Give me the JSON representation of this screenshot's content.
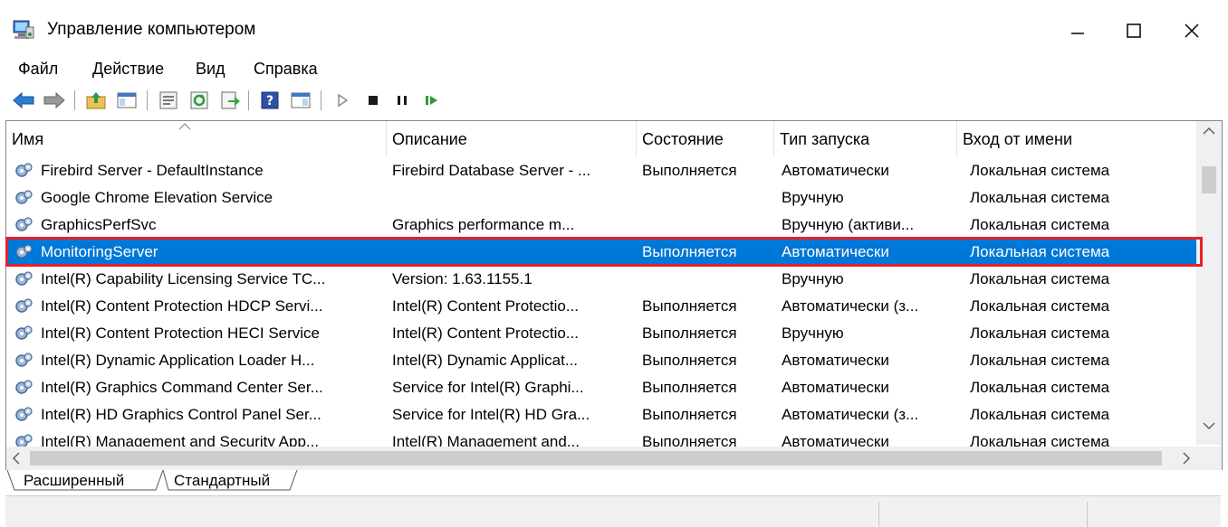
{
  "window": {
    "title": "Управление компьютером",
    "icon": "computer-management-icon"
  },
  "menu": [
    "Файл",
    "Действие",
    "Вид",
    "Справка"
  ],
  "toolbar": {
    "icons": [
      "back-arrow-icon",
      "forward-arrow-icon",
      "up-folder-icon",
      "console-tree-icon",
      "properties-icon",
      "refresh-icon",
      "export-list-icon",
      "help-icon",
      "show-hide-icon",
      "start-service-icon",
      "stop-service-icon",
      "pause-service-icon",
      "resume-service-icon"
    ]
  },
  "columns": [
    "Имя",
    "Описание",
    "Состояние",
    "Тип запуска",
    "Вход от имени"
  ],
  "rows": [
    {
      "name": "Firebird Server - DefaultInstance",
      "description": "Firebird Database Server - ...",
      "status": "Выполняется",
      "startup": "Автоматически",
      "logon": "Локальная система"
    },
    {
      "name": "Google Chrome Elevation Service",
      "description": "",
      "status": "",
      "startup": "Вручную",
      "logon": "Локальная система"
    },
    {
      "name": "GraphicsPerfSvc",
      "description": "Graphics performance m...",
      "status": "",
      "startup": "Вручную (активи...",
      "logon": "Локальная система"
    },
    {
      "name": "MonitoringServer",
      "description": "",
      "status": "Выполняется",
      "startup": "Автоматически",
      "logon": "Локальная система",
      "selected": true
    },
    {
      "name": "Intel(R) Capability Licensing Service TC...",
      "description": "Version: 1.63.1155.1",
      "status": "",
      "startup": "Вручную",
      "logon": "Локальная система"
    },
    {
      "name": "Intel(R) Content Protection HDCP Servi...",
      "description": "Intel(R) Content Protectio...",
      "status": "Выполняется",
      "startup": "Автоматически (з...",
      "logon": "Локальная система"
    },
    {
      "name": "Intel(R) Content Protection HECI Service",
      "description": "Intel(R) Content Protectio...",
      "status": "Выполняется",
      "startup": "Вручную",
      "logon": "Локальная система"
    },
    {
      "name": "Intel(R) Dynamic Application Loader H...",
      "description": "Intel(R) Dynamic Applicat...",
      "status": "Выполняется",
      "startup": "Автоматически",
      "logon": "Локальная система"
    },
    {
      "name": "Intel(R) Graphics Command Center Ser...",
      "description": "Service for Intel(R) Graphi...",
      "status": "Выполняется",
      "startup": "Автоматически",
      "logon": "Локальная система"
    },
    {
      "name": "Intel(R) HD Graphics Control Panel Ser...",
      "description": "Service for Intel(R) HD Gra...",
      "status": "Выполняется",
      "startup": "Автоматически (з...",
      "logon": "Локальная система"
    },
    {
      "name": "Intel(R) Management and Security App...",
      "description": "Intel(R) Management and...",
      "status": "Выполняется",
      "startup": "Автоматически",
      "logon": "Локальная система"
    }
  ],
  "tabs": [
    "Расширенный",
    "Стандартный"
  ],
  "colors": {
    "selection": "#0078d7",
    "highlight_border": "#e8202a"
  }
}
